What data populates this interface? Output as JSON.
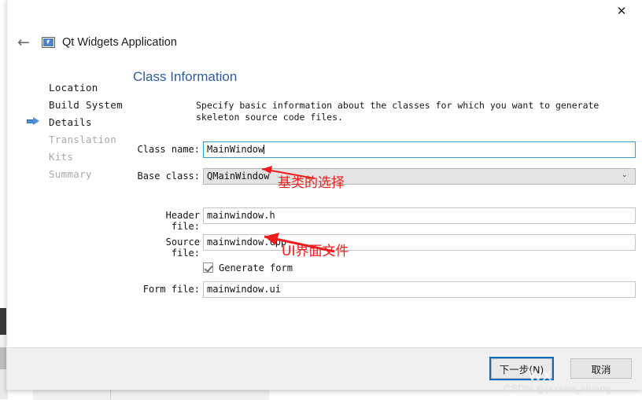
{
  "window": {
    "close_label": "✕",
    "back_label": "←",
    "wizard_title": "Qt Widgets Application",
    "icon": "application-window-icon"
  },
  "steps": [
    {
      "label": "Location",
      "state": "done"
    },
    {
      "label": "Build System",
      "state": "done"
    },
    {
      "label": "Details",
      "state": "current"
    },
    {
      "label": "Translation",
      "state": "todo"
    },
    {
      "label": "Kits",
      "state": "todo"
    },
    {
      "label": "Summary",
      "state": "todo"
    }
  ],
  "page": {
    "title": "Class Information",
    "description": "Specify basic information about the classes for which you want to generate skeleton source code files."
  },
  "form": {
    "class_name": {
      "label": "Class name:",
      "value": "MainWindow"
    },
    "base_class": {
      "label": "Base class:",
      "value": "QMainWindow",
      "arrow": "⌄"
    },
    "header_file": {
      "label": "Header file:",
      "value": "mainwindow.h"
    },
    "source_file": {
      "label": "Source file:",
      "value": "mainwindow.cpp"
    },
    "generate_form": {
      "label": "Generate form",
      "checked": true
    },
    "form_file": {
      "label": "Form file:",
      "value": "mainwindow.ui"
    }
  },
  "annotations": [
    {
      "text": "基类的选择",
      "color": "#f01b1b"
    },
    {
      "text": "UI界面文件",
      "color": "#f01b1b"
    }
  ],
  "footer": {
    "next_label": "下一步(N)",
    "cancel_label": "取消"
  },
  "watermark": {
    "big": "wx",
    "small": "CSDN @jaxsen_Huang"
  }
}
